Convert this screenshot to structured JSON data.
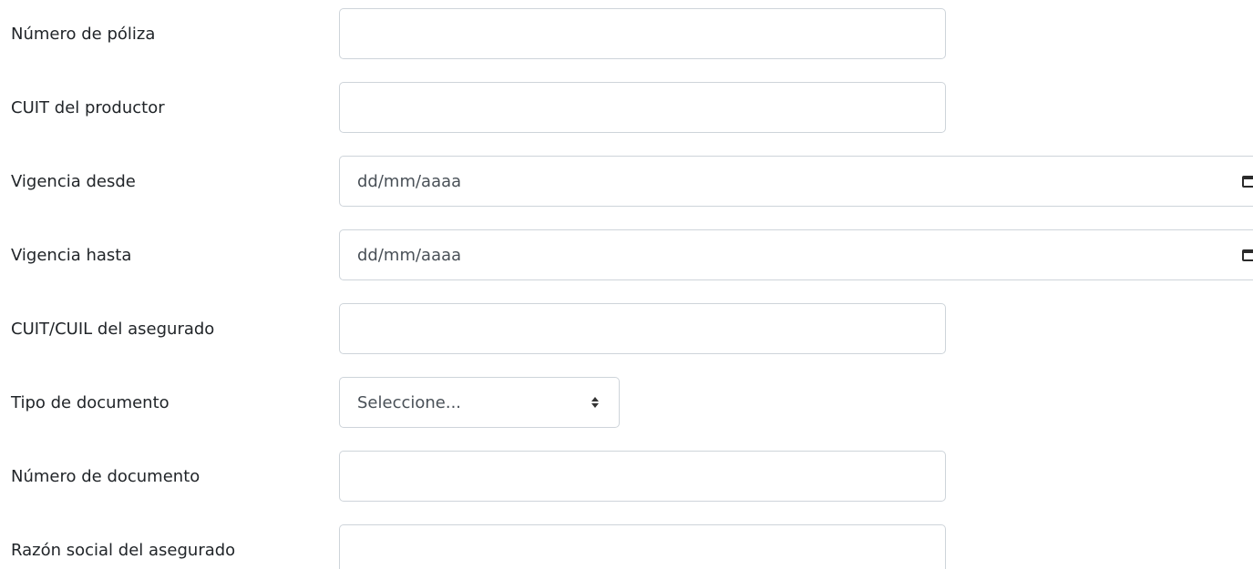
{
  "form": {
    "fields": [
      {
        "label": "Número de póliza",
        "type": "text",
        "value": ""
      },
      {
        "label": "CUIT del productor",
        "type": "text",
        "value": ""
      },
      {
        "label": "Vigencia desde",
        "type": "date",
        "placeholder": "dd/mm/aaaa",
        "icon": "calendar-icon"
      },
      {
        "label": "Vigencia hasta",
        "type": "date",
        "placeholder": "dd/mm/aaaa",
        "icon": "calendar-icon"
      },
      {
        "label": "CUIT/CUIL del asegurado",
        "type": "text",
        "value": ""
      },
      {
        "label": "Tipo de documento",
        "type": "select",
        "selected": "Seleccione...",
        "icon": "select-arrows-icon"
      },
      {
        "label": "Número de documento",
        "type": "text",
        "value": ""
      },
      {
        "label": "Razón social del asegurado",
        "type": "text",
        "value": ""
      }
    ]
  },
  "colors": {
    "border": "#ced4da",
    "label_text": "#212529",
    "input_text": "#495057"
  }
}
